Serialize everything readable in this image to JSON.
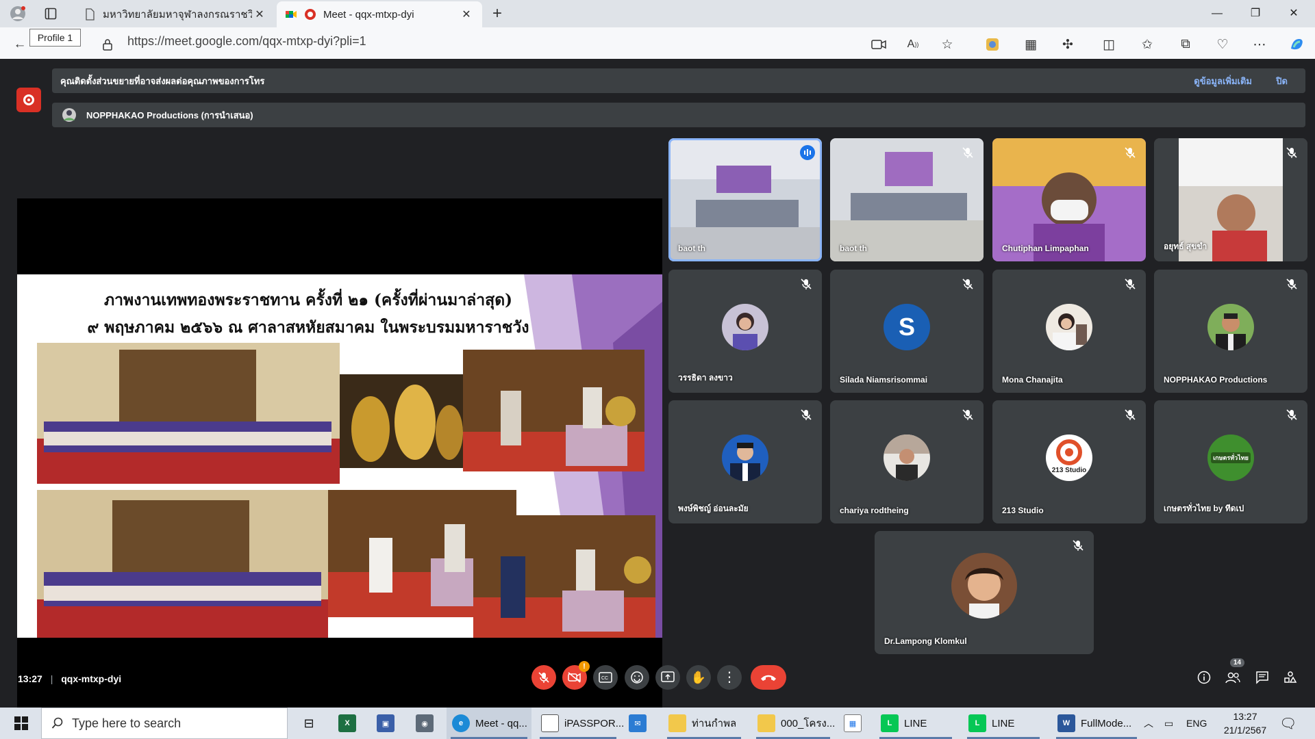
{
  "browser": {
    "tabs": [
      {
        "title": "มหาวิทยาลัยมหาจุฬาลงกรณราชวิทยาลัย",
        "active": false
      },
      {
        "title": "Meet - qqx-mtxp-dyi",
        "active": true
      }
    ],
    "tooltip": "Profile 1",
    "url": "https://meet.google.com/qqx-mtxp-dyi?pli=1"
  },
  "meet": {
    "extension_banner": {
      "text": "คุณติดตั้งส่วนขยายที่อาจส่งผลต่อคุณภาพของการโทร",
      "learn_more": "ดูข้อมูลเพิ่มเติม",
      "dismiss": "ปิด"
    },
    "presenter_banner": "NOPPHAKAO Productions (การนำเสนอ)",
    "slide": {
      "title_line1": "ภาพงานเทพทองพระราชทาน ครั้งที่ ๒๑ (ครั้งที่ผ่านมาล่าสุด)",
      "title_line2": "๙ พฤษภาคม ๒๕๖๖ ณ ศาลาสหหัยสมาคม ในพระบรมมหาราชวัง"
    },
    "participants": [
      {
        "name": "baot th",
        "type": "video"
      },
      {
        "name": "baot th",
        "type": "video"
      },
      {
        "name": "Chutiphan Limpaphan",
        "type": "video"
      },
      {
        "name": "อยุทธ์ สุขขำ",
        "type": "video"
      },
      {
        "name": "วรรธิดา ลงขาว",
        "type": "avatar"
      },
      {
        "name": "Silada Niamsrisommai",
        "type": "letter",
        "letter": "S"
      },
      {
        "name": "Mona Chanajita",
        "type": "avatar"
      },
      {
        "name": "NOPPHAKAO Productions",
        "type": "avatar"
      },
      {
        "name": "พงษ์พิชญ์ อ่อนละมัย",
        "type": "avatar"
      },
      {
        "name": "chariya rodtheing",
        "type": "avatar"
      },
      {
        "name": "213 Studio",
        "type": "avatar",
        "logo_text": "213 Studio"
      },
      {
        "name": "เกษตรทั่วไทย by ทีดเป",
        "type": "avatar",
        "logo_text": "เกษตรทั่วไทย"
      },
      {
        "name": "Dr.Lampong Klomkul",
        "type": "avatar"
      }
    ],
    "time": "13:27",
    "meeting_code": "qqx-mtxp-dyi",
    "camera_badge": "!",
    "people_count": "14"
  },
  "taskbar": {
    "search_placeholder": "Type here to search",
    "apps": [
      {
        "label": "Meet - qq..."
      },
      {
        "label": "iPASSPOR..."
      },
      {
        "label": "ท่านกำพล"
      },
      {
        "label": "000_โครง..."
      },
      {
        "label": "LINE"
      },
      {
        "label": "LINE"
      },
      {
        "label": "FullMode..."
      }
    ],
    "language": "ENG",
    "clock_time": "13:27",
    "clock_date": "21/1/2567"
  },
  "colors": {
    "meet_bg": "#202124",
    "tile_bg": "#3c4043",
    "danger": "#ea4335",
    "accent_blue": "#8ab4f8"
  }
}
